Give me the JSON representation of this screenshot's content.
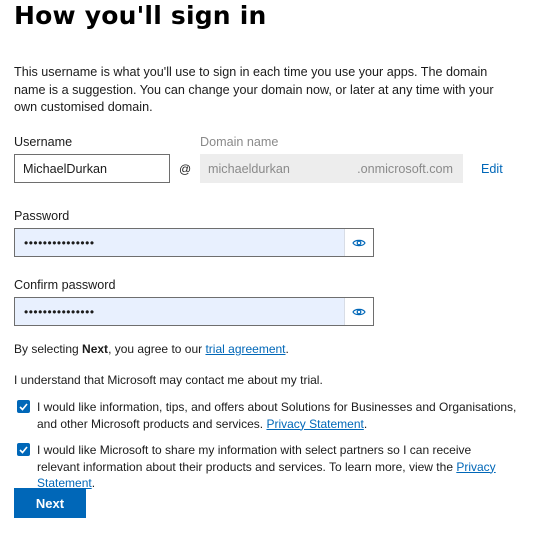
{
  "page": {
    "title": "How you'll sign in",
    "description": "This username is what you'll use to sign in each time you use your apps. The domain name is a suggestion. You can change your domain now, or later at any time with your own customised domain."
  },
  "username": {
    "label": "Username",
    "value": "MichaelDurkan"
  },
  "at_symbol": "@",
  "domain": {
    "label": "Domain name",
    "value": "michaeldurkan",
    "suffix": ".onmicrosoft.com",
    "edit_label": "Edit"
  },
  "password": {
    "label": "Password",
    "masked_value": "•••••••••••••••"
  },
  "confirm_password": {
    "label": "Confirm password",
    "masked_value": "•••••••••••••••"
  },
  "agreement": {
    "prefix": "By selecting ",
    "bold": "Next",
    "middle": ", you agree to our ",
    "link": "trial agreement",
    "suffix": "."
  },
  "contact_notice": "I understand that Microsoft may contact me about my trial.",
  "checkbox1": {
    "checked": true,
    "text": "I would like information, tips, and offers about Solutions for Businesses and Organisations, and other Microsoft products and services. ",
    "link": "Privacy Statement",
    "suffix": "."
  },
  "checkbox2": {
    "checked": true,
    "text": "I would like Microsoft to share my information with select partners so I can receive relevant information about their products and services. To learn more, view the ",
    "link": "Privacy Statement",
    "suffix": "."
  },
  "next_button": "Next",
  "colors": {
    "accent": "#0067b8",
    "autofill_bg": "#e8f0fe",
    "disabled_bg": "#ededed"
  },
  "icons": {
    "reveal": "eye-icon",
    "check": "checkmark-icon"
  }
}
